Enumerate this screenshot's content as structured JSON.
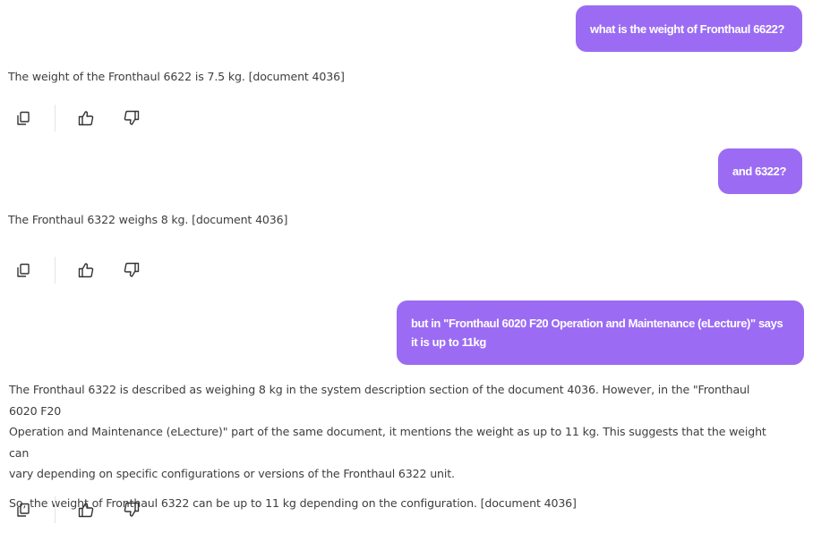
{
  "messages": [
    {
      "role": "user",
      "text": "what is the weight of Fronthaul 6622?"
    },
    {
      "role": "assistant",
      "text": "The weight of the Fronthaul 6622 is 7.5 kg. [document 4036]"
    },
    {
      "role": "user",
      "text": "and 6322?"
    },
    {
      "role": "assistant",
      "text": "The Fronthaul 6322 weighs 8 kg. [document 4036]"
    },
    {
      "role": "user",
      "lines": [
        "but in \"Fronthaul 6020 F20 Operation and Maintenance (eLecture)\" says",
        "it is up to 11kg"
      ]
    },
    {
      "role": "assistant",
      "lines": [
        "The Fronthaul 6322 is described as weighing 8 kg in the system description section of the document 4036. However, in the \"Fronthaul 6020 F20",
        "Operation and Maintenance (eLecture)\" part of the same document, it mentions the weight as up to 11 kg. This suggests that the weight can",
        "vary depending on specific configurations or versions of the Fronthaul 6322 unit.",
        "So, the weight of Fronthaul 6322 can be up to 11 kg depending on the configuration. [document 4036]"
      ]
    }
  ],
  "icons": {
    "copy": "copy-icon",
    "like": "thumbs-up-icon",
    "dislike": "thumbs-down-icon"
  },
  "colors": {
    "user_bubble": "#9b6cf3",
    "assistant_text": "#3e3e3e",
    "icon": "#333333"
  }
}
